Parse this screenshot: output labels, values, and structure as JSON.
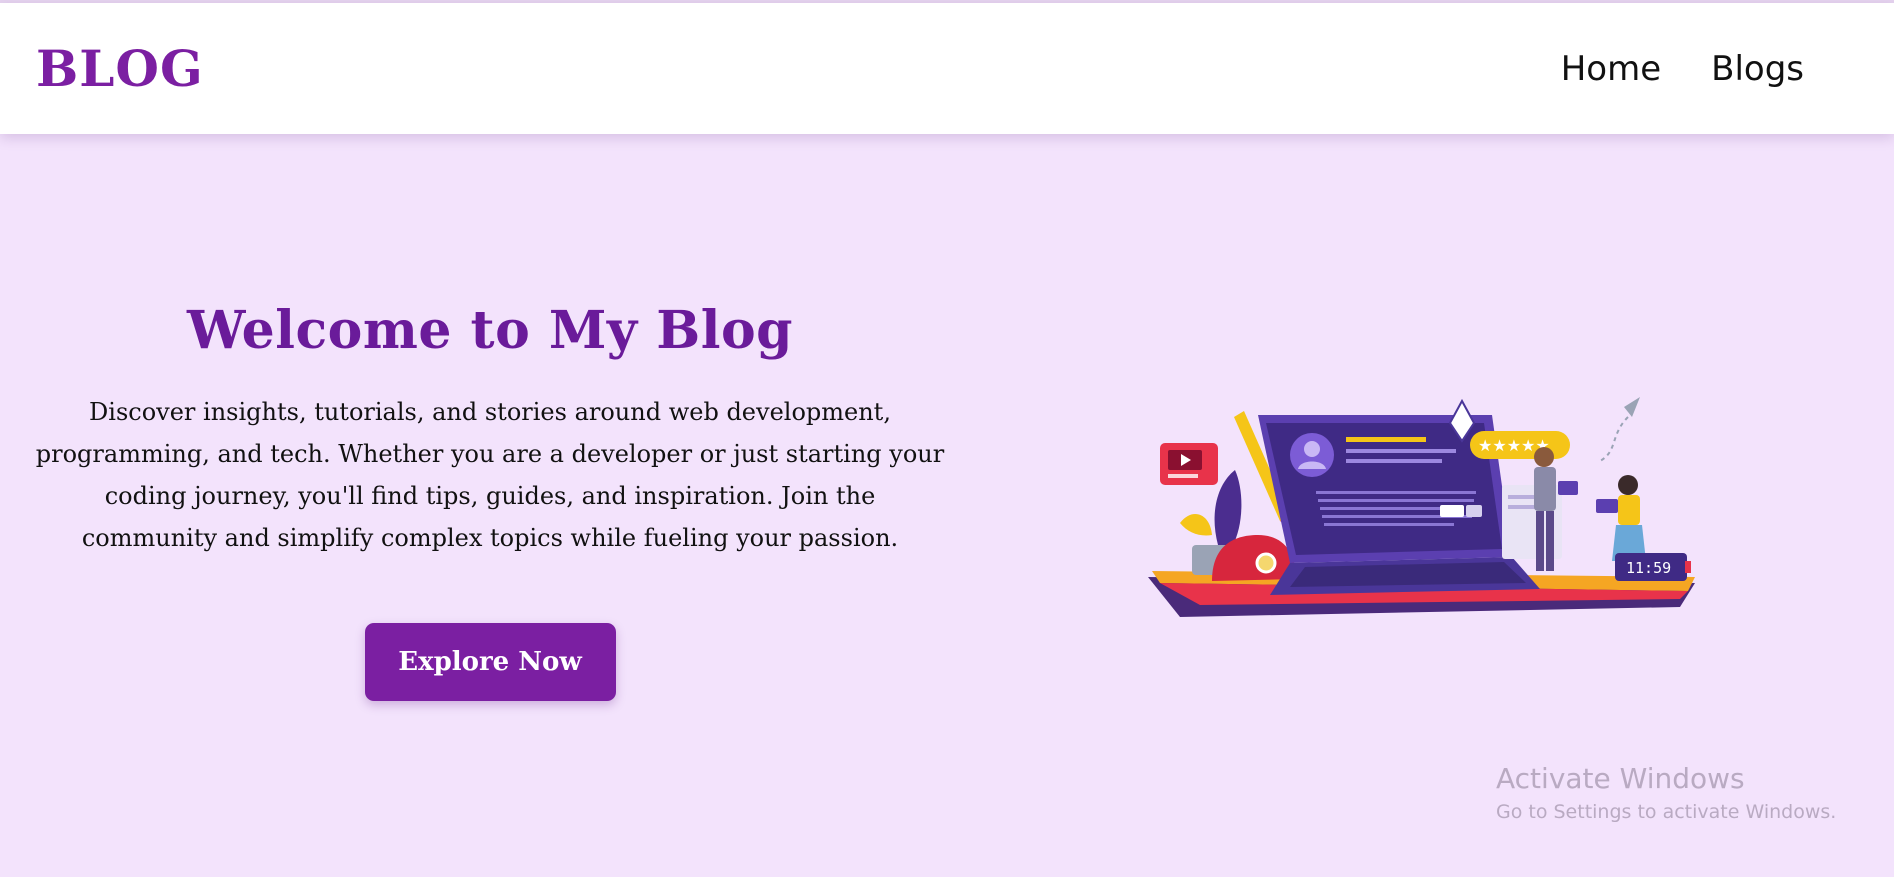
{
  "navbar": {
    "brand": "BLOG",
    "links": [
      {
        "label": "Home"
      },
      {
        "label": "Blogs"
      }
    ]
  },
  "hero": {
    "title": "Welcome to My Blog",
    "description": "Discover insights, tutorials, and stories around web development, programming, and tech. Whether you are a developer or just starting your coding journey, you'll find tips, guides, and inspiration. Join the community and simplify complex topics while fueling your passion.",
    "cta_label": "Explore Now"
  },
  "illustration": {
    "clock_text": "11:59",
    "rating_stars": 5
  },
  "watermark": {
    "title": "Activate Windows",
    "subtitle": "Go to Settings to activate Windows."
  },
  "colors": {
    "brand": "#7b1fa2",
    "title": "#6a1b9a",
    "background": "#f3e3fc",
    "navbar": "#ffffff"
  }
}
